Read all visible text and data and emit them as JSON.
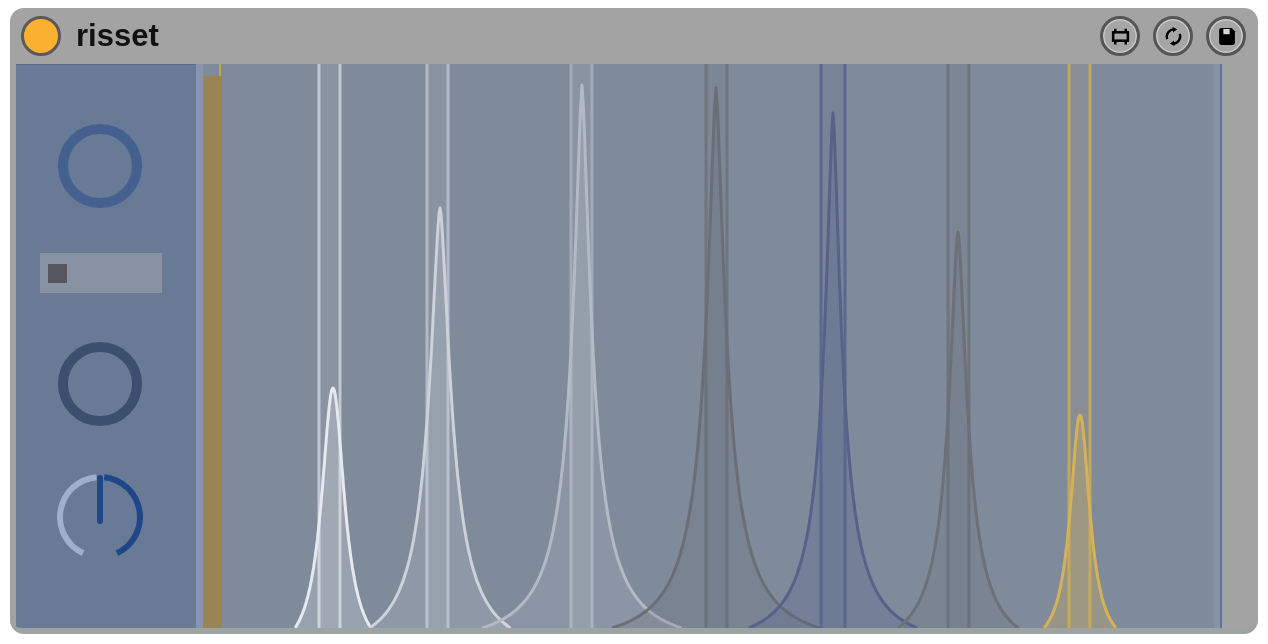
{
  "device": {
    "title": "risset",
    "power": {
      "on": true
    }
  },
  "controls": [
    {
      "kind": "ring",
      "on": true
    },
    {
      "kind": "switch",
      "on": false
    },
    {
      "kind": "ring",
      "on": false
    },
    {
      "kind": "dial",
      "level": 0.5
    }
  ]
}
